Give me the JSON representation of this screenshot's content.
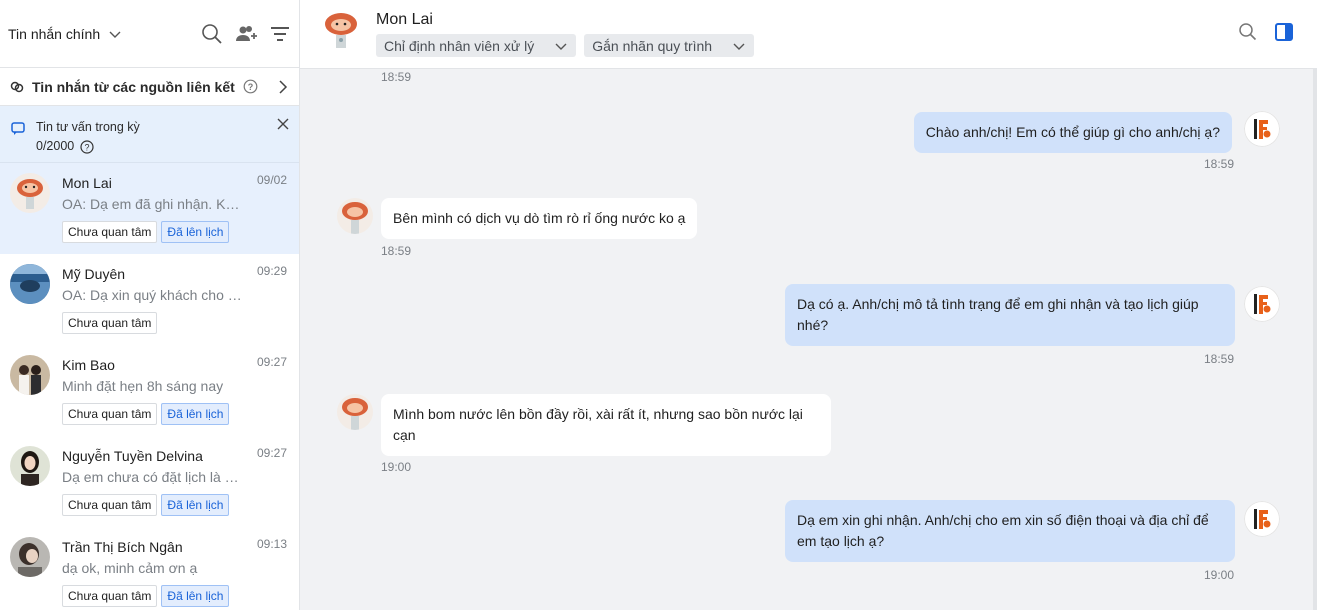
{
  "sidebar": {
    "title": "Tin nhắn chính",
    "linked_sources": "Tin nhắn từ các nguồn liên kết",
    "quota": {
      "label": "Tin tư vấn trong kỳ",
      "count": "0/2000"
    },
    "conversations": [
      {
        "name": "Mon Lai",
        "time": "09/02",
        "preview": "OA: Dạ em đã ghi nhận. KTV sẽ liên hệ lại",
        "tags": [
          "Chưa quan tâm",
          "Đã lên lịch"
        ]
      },
      {
        "name": "Mỹ Duyên",
        "time": "09:29",
        "preview": "OA: Dạ xin quý khách cho biết thêm",
        "tags": [
          "Chưa quan tâm"
        ]
      },
      {
        "name": "Kim Bao",
        "time": "09:27",
        "preview": "Minh đặt hẹn 8h sáng nay",
        "tags": [
          "Chưa quan tâm",
          "Đã lên lịch"
        ]
      },
      {
        "name": "Nguyễn Tuyền Delvina",
        "time": "09:27",
        "preview": "Dạ em chưa có đặt lịch là sao ạ",
        "tags": [
          "Chưa quan tâm",
          "Đã lên lịch"
        ]
      },
      {
        "name": "Trần Thị Bích Ngân",
        "time": "09:13",
        "preview": "dạ ok, minh cảm ơn ạ",
        "tags": [
          "Chưa quan tâm",
          "Đã lên lịch"
        ]
      }
    ]
  },
  "chat": {
    "contact_name": "Mon Lai",
    "assign_button": "Chỉ định nhân viên xử lý",
    "label_button": "Gắn nhãn quy trình",
    "messages": [
      {
        "direction": "in",
        "time": "18:59",
        "text": ""
      },
      {
        "direction": "out",
        "time": "18:59",
        "text": "Chào anh/chị! Em có thể giúp gì cho anh/chị ạ?"
      },
      {
        "direction": "in",
        "time": "18:59",
        "text": "Bên mình có dịch vụ dò tìm rò rỉ ống nước ko ạ"
      },
      {
        "direction": "out",
        "time": "18:59",
        "text": "Dạ có ạ. Anh/chị mô tả tình trạng để em ghi nhận và tạo lịch giúp nhé?"
      },
      {
        "direction": "in",
        "time": "19:00",
        "text": "Mình bom nước lên bồn đầy rồi, xài rất ít, nhưng sao bồn nước lại cạn"
      },
      {
        "direction": "out",
        "time": "19:00",
        "text": "Dạ em xin ghi nhận. Anh/chị cho em xin số điện thoại và địa chỉ để em tạo lịch ạ?"
      }
    ]
  },
  "colors": {
    "accent": "#1a63d8",
    "active_row": "#e7f0fd",
    "out_bubble": "#d0e1fa",
    "brand_orange": "#e8611a"
  },
  "icons": [
    "chevron-down-icon",
    "search-icon",
    "add-friend-icon",
    "filter-icon",
    "link-icon",
    "help-icon",
    "chevron-right-icon",
    "chat-icon",
    "close-icon",
    "sidebar-panel-icon"
  ]
}
